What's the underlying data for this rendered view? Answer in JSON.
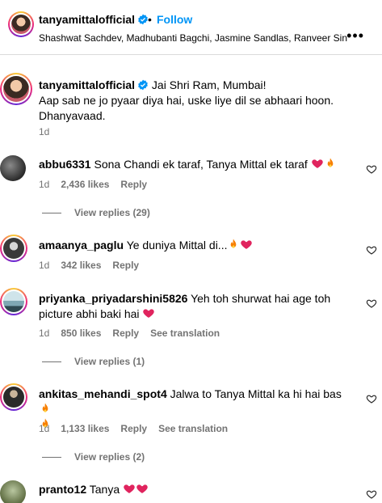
{
  "header": {
    "username": "tanyamittalofficial",
    "dot": "•",
    "follow_label": "Follow",
    "subtitle": "Shashwat Sachdev, Madhubanti Bagchi, Jasmine Sandlas, Ranveer Sin...",
    "more_label": "•••",
    "verified_icon": "verified-badge-icon"
  },
  "caption": {
    "username": "tanyamittalofficial",
    "line1": "Jai Shri Ram, Mumbai!",
    "line2": "Aap sab ne jo pyaar diya hai, uske liye dil se abhaari hoon.",
    "line3": "Dhanyavaad.",
    "time": "1d"
  },
  "comments": [
    {
      "username": "abbu6331",
      "text": "Sona Chandi ek taraf, Tanya Mittal ek taraf",
      "emojis": [
        "heart",
        "fire"
      ],
      "time": "1d",
      "likes": "2,436 likes",
      "reply": "Reply",
      "view_replies": "View replies (29)"
    },
    {
      "username": "amaanya_paglu",
      "text": "Ye duniya Mittal di...",
      "emojis": [
        "fire",
        "heart"
      ],
      "time": "1d",
      "likes": "342 likes",
      "reply": "Reply"
    },
    {
      "username": "priyanka_priyadarshini5826",
      "text": "Yeh toh shurwat hai age toh picture abhi baki hai",
      "emojis": [
        "heart"
      ],
      "time": "1d",
      "likes": "850 likes",
      "reply": "Reply",
      "translate": "See translation",
      "view_replies": "View replies (1)"
    },
    {
      "username": "ankitas_mehandi_spot4",
      "text": "Jalwa to Tanya Mittal ka hi hai bas",
      "emojis": [
        "fire",
        "fire"
      ],
      "time": "1d",
      "likes": "1,133 likes",
      "reply": "Reply",
      "translate": "See translation",
      "view_replies": "View replies (2)"
    },
    {
      "username": "pranto12",
      "text": "Tanya",
      "emojis": [
        "heart",
        "heart"
      ]
    }
  ],
  "colors": {
    "follow": "#0095f6",
    "meta": "#737373",
    "heart": "#e0245e",
    "fire": "#f77f00"
  }
}
